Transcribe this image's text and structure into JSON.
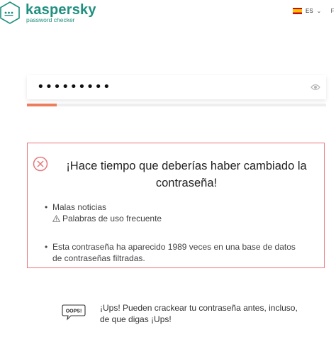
{
  "header": {
    "brand": "kaspersky",
    "subtitle": "password checker",
    "language": "ES",
    "extra": "F"
  },
  "password": {
    "masked_value": "•••••••••",
    "strength_fraction": 0.1
  },
  "result": {
    "headline": "¡Hace tiempo que deberías haber cambiado la contraseña!",
    "bullet1": "Malas noticias",
    "bullet1_detail": "Palabras de uso frecuente",
    "bullet2": "Esta contraseña ha aparecido 1989 veces en una base de datos de contraseñas filtradas."
  },
  "oops": {
    "badge": "OOPS!",
    "text": "¡Ups! Pueden crackear tu contraseña antes, incluso, de que digas ¡Ups!"
  },
  "colors": {
    "brand": "#1f8f7f",
    "danger": "#e8767a",
    "strength": "#ec7e5e"
  }
}
